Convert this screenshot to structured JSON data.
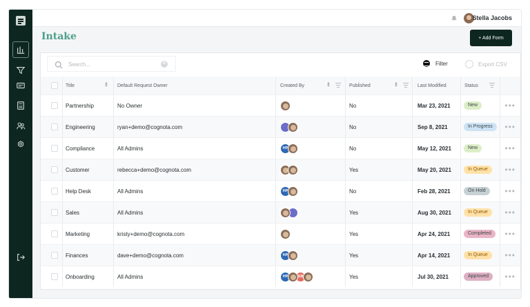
{
  "topbar": {
    "user_name": "Stella Jacobs"
  },
  "page": {
    "title": "Intake",
    "add_form_label": "+ Add Form",
    "search_placeholder": "Search...",
    "filter_label": "Filter",
    "export_label": "Export CSV"
  },
  "table": {
    "headers": [
      "Title",
      "Default Request Owner",
      "Created By",
      "Published",
      "Last Modified",
      "Status"
    ],
    "rows": [
      {
        "title": "Partnership",
        "owner": "No Owner",
        "published": "No",
        "modified": "Mar 23, 2021",
        "status": "New",
        "creators": [
          {
            "type": "photo"
          }
        ]
      },
      {
        "title": "Engineering",
        "owner": "ryan+demo@cognota.com",
        "published": "No",
        "modified": "Sep 8, 2021",
        "status": "In Progress",
        "creators": [
          {
            "type": "purple"
          },
          {
            "type": "photo"
          }
        ]
      },
      {
        "title": "Compliance",
        "owner": "All Admins",
        "published": "No",
        "modified": "May 12, 2021",
        "status": "New",
        "creators": [
          {
            "type": "blue",
            "label": "HP"
          },
          {
            "type": "photo"
          }
        ]
      },
      {
        "title": "Customer",
        "owner": "rebecca+demo@cognota.com",
        "published": "Yes",
        "modified": "May 20, 2021",
        "status": "In Queue",
        "creators": [
          {
            "type": "photo"
          },
          {
            "type": "photo"
          }
        ]
      },
      {
        "title": "Help Desk",
        "owner": "All Admins",
        "published": "No",
        "modified": "Feb 28, 2021",
        "status": "On Hold",
        "creators": [
          {
            "type": "blue",
            "label": "HP"
          },
          {
            "type": "photo"
          }
        ]
      },
      {
        "title": "Sales",
        "owner": "All Admins",
        "published": "Yes",
        "modified": "Aug 30, 2021",
        "status": "In Queue",
        "creators": [
          {
            "type": "photo"
          },
          {
            "type": "purple"
          }
        ]
      },
      {
        "title": "Marketing",
        "owner": "kristy+demo@cognota.com",
        "published": "Yes",
        "modified": "Apr 24, 2021",
        "status": "Completed",
        "creators": [
          {
            "type": "photo"
          }
        ]
      },
      {
        "title": "Finances",
        "owner": "dave+demo@cognota.com",
        "published": "Yes",
        "modified": "Apr 14, 2021",
        "status": "In Queue",
        "creators": [
          {
            "type": "blue",
            "label": "HP"
          },
          {
            "type": "photo"
          }
        ]
      },
      {
        "title": "Onboarding",
        "owner": "All Admins",
        "published": "Yes",
        "modified": "Jul 30, 2021",
        "status": "Approved",
        "creators": [
          {
            "type": "blue",
            "label": "HP"
          },
          {
            "type": "photo"
          },
          {
            "type": "red",
            "label": "SB"
          },
          {
            "type": "photo"
          }
        ]
      }
    ]
  },
  "status_colors": {
    "New": "#dceec7",
    "In Progress": "#cde3f5",
    "In Queue": "#ffe1a8",
    "On Hold": "#c6d1d6",
    "Completed": "#e9b5c6",
    "Approved": "#ddb0c2"
  },
  "icons": [
    "document-logo-icon",
    "chart-icon",
    "funnel-icon",
    "message-icon",
    "calculator-icon",
    "users-icon",
    "settings-icon",
    "logout-icon",
    "bell-icon",
    "search-icon",
    "clear-icon",
    "filter-icon",
    "export-icon",
    "sort-icon",
    "column-filter-icon",
    "more-icon"
  ]
}
